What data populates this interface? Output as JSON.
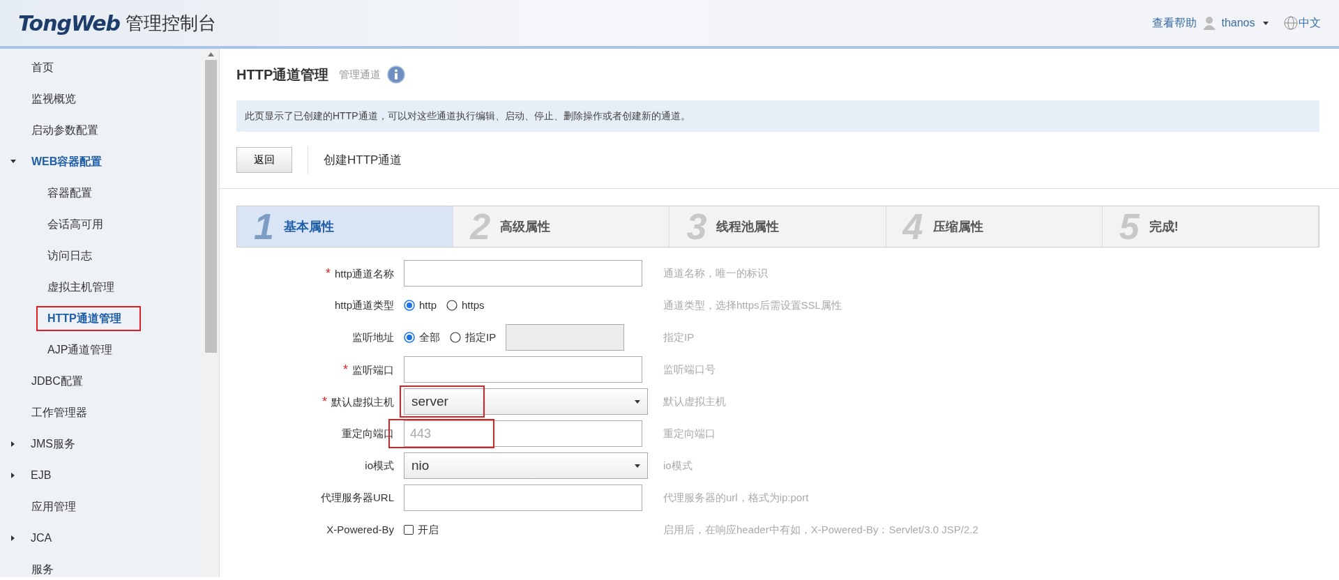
{
  "header": {
    "logo": "TongWeb",
    "title": "管理控制台",
    "help": "查看帮助",
    "user": "thanos",
    "language": "中文"
  },
  "sidebar": {
    "items": [
      {
        "label": "首页",
        "kind": "link",
        "selected": false
      },
      {
        "label": "监视概览",
        "kind": "link",
        "selected": false
      },
      {
        "label": "启动参数配置",
        "kind": "link",
        "selected": false
      },
      {
        "label": "WEB容器配置",
        "kind": "group",
        "expanded": true,
        "selected": true,
        "children": [
          {
            "label": "容器配置",
            "kind": "link",
            "selected": false
          },
          {
            "label": "会话高可用",
            "kind": "link",
            "selected": false
          },
          {
            "label": "访问日志",
            "kind": "link",
            "selected": false
          },
          {
            "label": "虚拟主机管理",
            "kind": "link",
            "selected": false
          },
          {
            "label": "HTTP通道管理",
            "kind": "link",
            "selected": true,
            "highlighted": true
          },
          {
            "label": "AJP通道管理",
            "kind": "link",
            "selected": false
          }
        ]
      },
      {
        "label": "JDBC配置",
        "kind": "link",
        "selected": false
      },
      {
        "label": "工作管理器",
        "kind": "link",
        "selected": false
      },
      {
        "label": "JMS服务",
        "kind": "group",
        "expanded": false,
        "selected": false
      },
      {
        "label": "EJB",
        "kind": "group",
        "expanded": false,
        "selected": false
      },
      {
        "label": "应用管理",
        "kind": "link",
        "selected": false
      },
      {
        "label": "JCA",
        "kind": "group",
        "expanded": false,
        "selected": false
      },
      {
        "label": "服务",
        "kind": "link",
        "selected": false
      }
    ]
  },
  "page": {
    "title": "HTTP通道管理",
    "subtitle": "管理通道",
    "description": "此页显示了已创建的HTTP通道，可以对这些通道执行编辑、启动、停止、删除操作或者创建新的通道。",
    "back_button": "返回",
    "action_title": "创建HTTP通道"
  },
  "steps": [
    {
      "number": "1",
      "label": "基本属性",
      "selected": true
    },
    {
      "number": "2",
      "label": "高级属性",
      "selected": false
    },
    {
      "number": "3",
      "label": "线程池属性",
      "selected": false
    },
    {
      "number": "4",
      "label": "压缩属性",
      "selected": false
    },
    {
      "number": "5",
      "label": "完成!",
      "selected": false
    }
  ],
  "form": [
    {
      "kind": "text",
      "label": "http通道名称",
      "required_mark": "*",
      "hint": "通道名称，唯一的标识"
    },
    {
      "kind": "radio",
      "label": "http通道类型",
      "options": [
        {
          "label": "http",
          "selected": true
        },
        {
          "label": "https",
          "selected": false
        }
      ],
      "hint": "通道类型，选择https后需设置SSL属性"
    },
    {
      "kind": "radio_input",
      "label": "监听地址",
      "options": [
        {
          "label": "全部",
          "selected": true
        },
        {
          "label": "指定IP",
          "selected": false
        }
      ],
      "disabled": true,
      "hint": "指定IP"
    },
    {
      "kind": "text",
      "label": "监听端口",
      "required_mark": "*",
      "hint": "监听端口号"
    },
    {
      "kind": "select",
      "label": "默认虚拟主机",
      "required_mark": "*",
      "value": "server",
      "highlighted": true,
      "hint": "默认虚拟主机"
    },
    {
      "kind": "text",
      "label": "重定向端口",
      "placeholder": "443",
      "highlighted": true,
      "hint": "重定向端口"
    },
    {
      "kind": "select",
      "label": "io模式",
      "value": "nio",
      "hint": "io模式"
    },
    {
      "kind": "text",
      "label": "代理服务器URL",
      "hint": "代理服务器的url，格式为ip:port"
    },
    {
      "kind": "checkbox",
      "label": "X-Powered-By",
      "option": "开启",
      "checked": false,
      "hint": "启用后，在响应header中有如，X-Powered-By：Servlet/3.0 JSP/2.2"
    }
  ]
}
